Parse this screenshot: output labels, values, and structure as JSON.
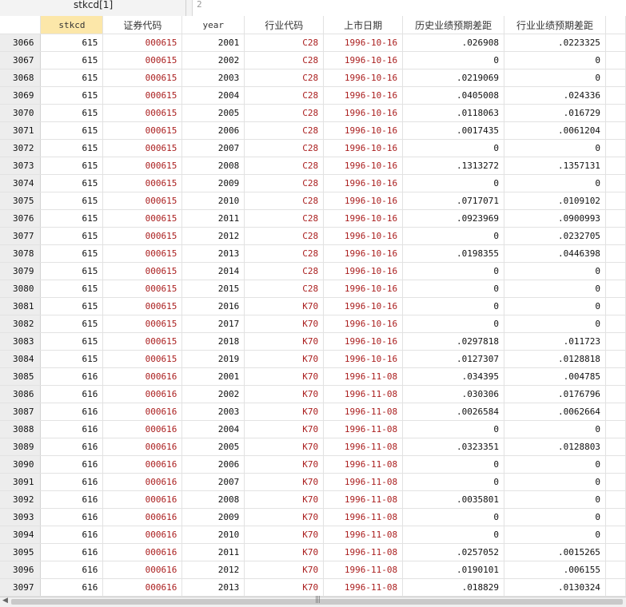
{
  "toolbar": {
    "cell_ref": "stkcd[1]",
    "cell_value": "2"
  },
  "columns": [
    "stkcd",
    "证券代码",
    "year",
    "行业代码",
    "上市日期",
    "历史业绩预期差距",
    "行业业绩预期差距"
  ],
  "selected_column": 0,
  "rows": [
    [
      "3066",
      "615",
      "000615",
      "2001",
      "C28",
      "1996-10-16",
      ".026908",
      ".0223325"
    ],
    [
      "3067",
      "615",
      "000615",
      "2002",
      "C28",
      "1996-10-16",
      "0",
      "0"
    ],
    [
      "3068",
      "615",
      "000615",
      "2003",
      "C28",
      "1996-10-16",
      ".0219069",
      "0"
    ],
    [
      "3069",
      "615",
      "000615",
      "2004",
      "C28",
      "1996-10-16",
      ".0405008",
      ".024336"
    ],
    [
      "3070",
      "615",
      "000615",
      "2005",
      "C28",
      "1996-10-16",
      ".0118063",
      ".016729"
    ],
    [
      "3071",
      "615",
      "000615",
      "2006",
      "C28",
      "1996-10-16",
      ".0017435",
      ".0061204"
    ],
    [
      "3072",
      "615",
      "000615",
      "2007",
      "C28",
      "1996-10-16",
      "0",
      "0"
    ],
    [
      "3073",
      "615",
      "000615",
      "2008",
      "C28",
      "1996-10-16",
      ".1313272",
      ".1357131"
    ],
    [
      "3074",
      "615",
      "000615",
      "2009",
      "C28",
      "1996-10-16",
      "0",
      "0"
    ],
    [
      "3075",
      "615",
      "000615",
      "2010",
      "C28",
      "1996-10-16",
      ".0717071",
      ".0109102"
    ],
    [
      "3076",
      "615",
      "000615",
      "2011",
      "C28",
      "1996-10-16",
      ".0923969",
      ".0900993"
    ],
    [
      "3077",
      "615",
      "000615",
      "2012",
      "C28",
      "1996-10-16",
      "0",
      ".0232705"
    ],
    [
      "3078",
      "615",
      "000615",
      "2013",
      "C28",
      "1996-10-16",
      ".0198355",
      ".0446398"
    ],
    [
      "3079",
      "615",
      "000615",
      "2014",
      "C28",
      "1996-10-16",
      "0",
      "0"
    ],
    [
      "3080",
      "615",
      "000615",
      "2015",
      "C28",
      "1996-10-16",
      "0",
      "0"
    ],
    [
      "3081",
      "615",
      "000615",
      "2016",
      "K70",
      "1996-10-16",
      "0",
      "0"
    ],
    [
      "3082",
      "615",
      "000615",
      "2017",
      "K70",
      "1996-10-16",
      "0",
      "0"
    ],
    [
      "3083",
      "615",
      "000615",
      "2018",
      "K70",
      "1996-10-16",
      ".0297818",
      ".011723"
    ],
    [
      "3084",
      "615",
      "000615",
      "2019",
      "K70",
      "1996-10-16",
      ".0127307",
      ".0128818"
    ],
    [
      "3085",
      "616",
      "000616",
      "2001",
      "K70",
      "1996-11-08",
      ".034395",
      ".004785"
    ],
    [
      "3086",
      "616",
      "000616",
      "2002",
      "K70",
      "1996-11-08",
      ".030306",
      ".0176796"
    ],
    [
      "3087",
      "616",
      "000616",
      "2003",
      "K70",
      "1996-11-08",
      ".0026584",
      ".0062664"
    ],
    [
      "3088",
      "616",
      "000616",
      "2004",
      "K70",
      "1996-11-08",
      "0",
      "0"
    ],
    [
      "3089",
      "616",
      "000616",
      "2005",
      "K70",
      "1996-11-08",
      ".0323351",
      ".0128803"
    ],
    [
      "3090",
      "616",
      "000616",
      "2006",
      "K70",
      "1996-11-08",
      "0",
      "0"
    ],
    [
      "3091",
      "616",
      "000616",
      "2007",
      "K70",
      "1996-11-08",
      "0",
      "0"
    ],
    [
      "3092",
      "616",
      "000616",
      "2008",
      "K70",
      "1996-11-08",
      ".0035801",
      "0"
    ],
    [
      "3093",
      "616",
      "000616",
      "2009",
      "K70",
      "1996-11-08",
      "0",
      "0"
    ],
    [
      "3094",
      "616",
      "000616",
      "2010",
      "K70",
      "1996-11-08",
      "0",
      "0"
    ],
    [
      "3095",
      "616",
      "000616",
      "2011",
      "K70",
      "1996-11-08",
      ".0257052",
      ".0015265"
    ],
    [
      "3096",
      "616",
      "000616",
      "2012",
      "K70",
      "1996-11-08",
      ".0190101",
      ".006155"
    ],
    [
      "3097",
      "616",
      "000616",
      "2013",
      "K70",
      "1996-11-08",
      ".018829",
      ".0130324"
    ]
  ],
  "colors": {
    "string_text": "#aa1e1e",
    "selected_header": "#fce7a9",
    "row_number_bg": "#ededed"
  },
  "icons": {
    "scroll_left": "scroll-left-arrow-icon",
    "scroll_right": "scroll-right-arrow-icon",
    "grip": "scroll-grip-icon"
  }
}
